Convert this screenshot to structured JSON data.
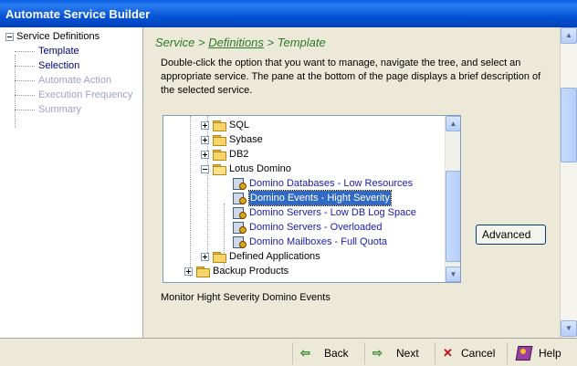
{
  "window": {
    "title": "Automate Service Builder"
  },
  "left_nav": {
    "root": "Service Definitions",
    "items": [
      {
        "label": "Template",
        "state": "active"
      },
      {
        "label": "Selection",
        "state": "active"
      },
      {
        "label": "Automate Action",
        "state": "disabled"
      },
      {
        "label": "Execution Frequency",
        "state": "disabled"
      },
      {
        "label": "Summary",
        "state": "disabled"
      }
    ]
  },
  "breadcrumb": {
    "part1": "Service",
    "sep1": ">",
    "part2": "Definitions",
    "sep2": ">",
    "part3": "Template"
  },
  "intro": "Double-click the option that you want to manage, navigate the tree, and select an appropriate service. The pane at the bottom of the page displays a brief description of the selected service.",
  "tree": {
    "sql": "SQL",
    "sybase": "Sybase",
    "db2": "DB2",
    "lotus": "Lotus Domino",
    "svc1": "Domino Databases - Low Resources",
    "svc2": "Domino Events - Hight Severity",
    "svc3": "Domino Servers - Low DB Log Space",
    "svc4": "Domino Servers - Overloaded",
    "svc5": "Domino Mailboxes - Full Quota",
    "defined": "Defined Applications",
    "backup": "Backup Products"
  },
  "advanced_label": "Advanced",
  "description": "Monitor Hight Severity Domino Events",
  "footer": {
    "back": "Back",
    "next": "Next",
    "cancel": "Cancel",
    "help": "Help"
  },
  "icons": {
    "back": "back-arrow-icon",
    "next": "next-arrow-icon",
    "cancel": "cancel-x-icon",
    "help": "help-book-icon"
  },
  "colors": {
    "title_bar": "#0554d6",
    "breadcrumb": "#2b7a2b",
    "link_service": "#1a1aa8",
    "selection": "#316ac5"
  }
}
